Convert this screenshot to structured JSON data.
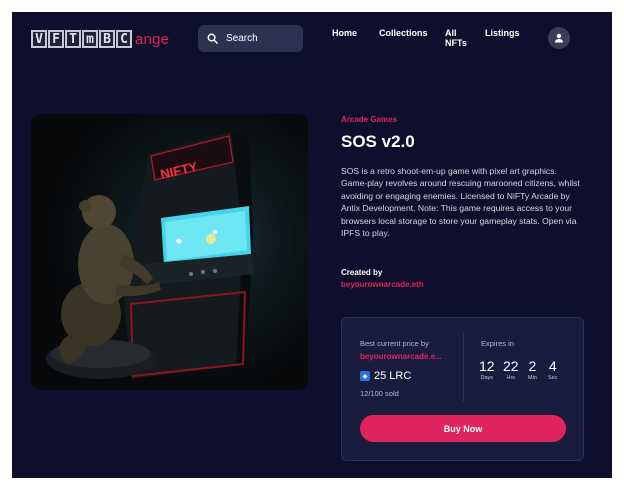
{
  "header": {
    "logo_letters": [
      "V",
      "F",
      "T",
      "m",
      "B",
      "C"
    ],
    "logo_suffix": "ange",
    "search_placeholder": "Search",
    "nav": [
      {
        "label": "Home"
      },
      {
        "label": "Collections"
      },
      {
        "label": "All NFTs"
      },
      {
        "label": "Listings"
      }
    ],
    "avatar_icon": "user-icon"
  },
  "artwork": {
    "marquee_text": "NIFTY"
  },
  "item": {
    "category": "Arcade Games",
    "title": "SOS v2.0",
    "description": "SOS is a retro shoot-em-up game with pixel art graphics. Game-play revolves around rescuing marooned citizens, whilst avoiding or engaging enemies. Licensed to NiFTy Arcade by Antix Development. Note: This game requires access to your browsers local storage to store your gameplay stats. Open via IPFS to play.",
    "created_label": "Created by",
    "creator": "beyourownarcade.eth"
  },
  "purchase": {
    "best_price_label": "Best current price by",
    "owner": "beyourownarcade.e...",
    "price": "25 LRC",
    "currency_icon": "lrc-icon",
    "sold": "12/100 sold",
    "expires_label": "Expires in",
    "countdown": [
      {
        "value": "12",
        "unit": "Days"
      },
      {
        "value": "22",
        "unit": "Hrs"
      },
      {
        "value": "2",
        "unit": "Min"
      },
      {
        "value": "4",
        "unit": "Sec"
      }
    ],
    "buy_label": "Buy Now"
  },
  "colors": {
    "background": "#0e0f2c",
    "accent": "#e0245e",
    "card": "#1a1c3d",
    "search": "#2f3150"
  }
}
